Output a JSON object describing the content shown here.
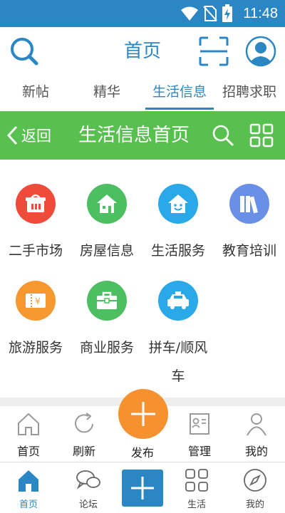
{
  "status_bar": {
    "time": "11:48"
  },
  "app_bar": {
    "title": "首页"
  },
  "tabs": [
    {
      "label": "新帖"
    },
    {
      "label": "精华"
    },
    {
      "label": "生活信息",
      "active": true
    },
    {
      "label": "招聘求职"
    }
  ],
  "section_header": {
    "back_label": "返回",
    "title": "生活信息首页"
  },
  "categories": [
    {
      "label": "二手市场",
      "icon": "basket-icon",
      "color": "#ef4b3a"
    },
    {
      "label": "房屋信息",
      "icon": "house-icon",
      "color": "#4cbf62"
    },
    {
      "label": "生活服务",
      "icon": "smile-house-icon",
      "color": "#29a9e8"
    },
    {
      "label": "教育培训",
      "icon": "books-icon",
      "color": "#6a8fe6"
    },
    {
      "label": "旅游服务",
      "icon": "ticket-icon",
      "color": "#f7982e"
    },
    {
      "label": "商业服务",
      "icon": "briefcase-icon",
      "color": "#4cbf62"
    },
    {
      "label": "拼车/顺风车",
      "label_line1": "拼车/顺风",
      "label_line2": "车",
      "icon": "taxi-icon",
      "color": "#29a9e8"
    }
  ],
  "action_bar": {
    "home": "首页",
    "refresh": "刷新",
    "publish": "发布",
    "manage": "管理",
    "mine": "我的"
  },
  "bottom_nav": {
    "home": "首页",
    "forum": "论坛",
    "life": "生活",
    "mine": "我的"
  },
  "colors": {
    "primary": "#2b87c4",
    "green": "#58c04f",
    "fab": "#f5922f"
  }
}
